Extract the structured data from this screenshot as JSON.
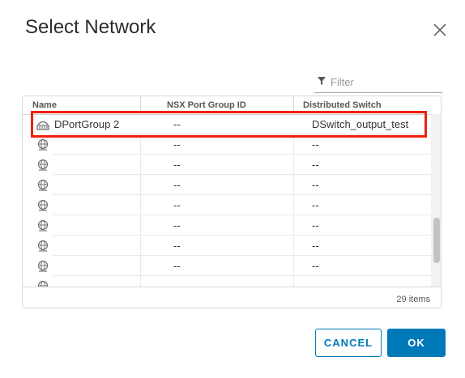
{
  "dialog": {
    "title": "Select Network",
    "filter_placeholder": "Filter"
  },
  "table": {
    "columns": [
      "Name",
      "NSX Port Group ID",
      "Distributed Switch"
    ],
    "rows": [
      {
        "name": "DPortGroup 2",
        "nsx": "--",
        "ds": "DSwitch_output_test",
        "icon": "port-group-icon"
      },
      {
        "name": "",
        "nsx": "--",
        "ds": "--",
        "icon": "network-icon"
      },
      {
        "name": "",
        "nsx": "--",
        "ds": "--",
        "icon": "network-icon"
      },
      {
        "name": "",
        "nsx": "--",
        "ds": "--",
        "icon": "network-icon"
      },
      {
        "name": "",
        "nsx": "--",
        "ds": "--",
        "icon": "network-icon"
      },
      {
        "name": "",
        "nsx": "--",
        "ds": "--",
        "icon": "network-icon"
      },
      {
        "name": "",
        "nsx": "--",
        "ds": "--",
        "icon": "network-icon"
      },
      {
        "name": "",
        "nsx": "--",
        "ds": "--",
        "icon": "network-icon"
      },
      {
        "name": "",
        "nsx": "",
        "ds": "",
        "icon": "network-icon"
      }
    ],
    "item_count": "29 items"
  },
  "buttons": {
    "cancel": "CANCEL",
    "ok": "OK"
  },
  "colors": {
    "accent": "#0079b8",
    "highlight": "#f0210b"
  }
}
